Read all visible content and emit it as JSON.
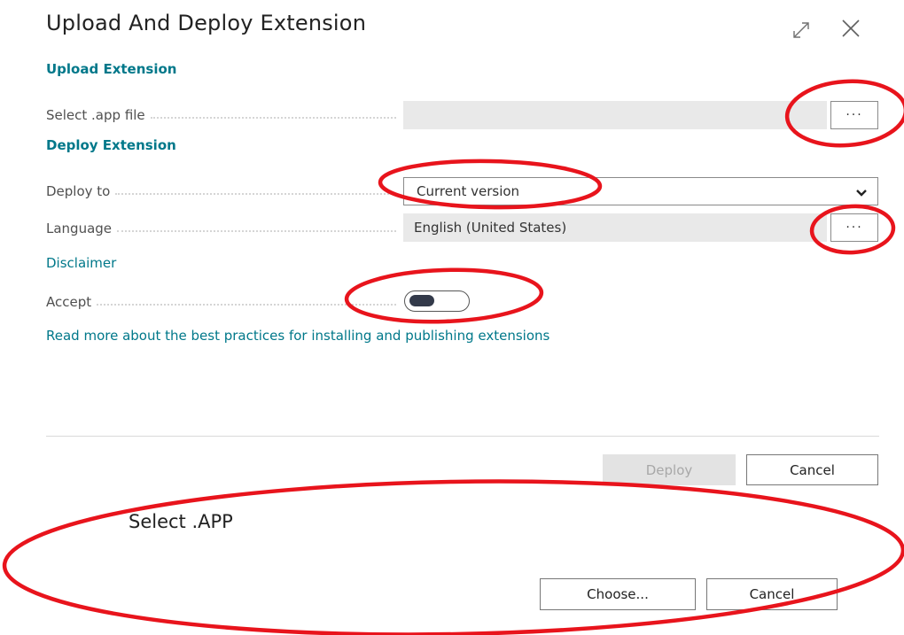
{
  "dialog": {
    "title": "Upload And Deploy Extension",
    "expand_icon": "expand-icon",
    "close_icon": "close-icon"
  },
  "upload_section": {
    "heading": "Upload Extension",
    "select_file_label": "Select .app file",
    "select_file_value": "",
    "browse_label": "···"
  },
  "deploy_section": {
    "heading": "Deploy Extension",
    "deploy_to_label": "Deploy to",
    "deploy_to_value": "Current version",
    "language_label": "Language",
    "language_value": "English (United States)",
    "language_lookup_label": "···",
    "disclaimer_link": "Disclaimer",
    "accept_label": "Accept",
    "accept_on": false,
    "best_practices_link": "Read more about the best practices for installing and publishing extensions"
  },
  "footer": {
    "deploy_label": "Deploy",
    "cancel_label": "Cancel"
  },
  "file_picker": {
    "title": "Select .APP",
    "choose_label": "Choose...",
    "cancel_label": "Cancel"
  },
  "colors": {
    "accent": "#00788a",
    "annotation": "#e8141c",
    "disabled_button": "#e3e3e3",
    "toggle_knob": "#333a4a"
  }
}
